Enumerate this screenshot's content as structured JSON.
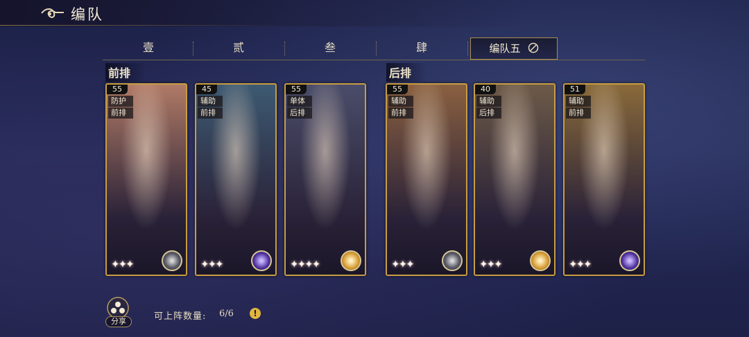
{
  "header": {
    "title": "编队"
  },
  "tabs": [
    {
      "label": "壹"
    },
    {
      "label": "贰"
    },
    {
      "label": "叁"
    },
    {
      "label": "肆"
    },
    {
      "label": "编队五",
      "active": true
    }
  ],
  "sections": {
    "front": "前排",
    "back": "后排"
  },
  "cards": [
    {
      "level": "55",
      "role": "防护",
      "position": "前排",
      "stars": 3,
      "element_icon": "moon-disc-icon",
      "bg": "#b07a66"
    },
    {
      "level": "45",
      "role": "辅助",
      "position": "前排",
      "stars": 3,
      "element_icon": "purple-orb-icon",
      "bg": "#3d5a72"
    },
    {
      "level": "55",
      "role": "单体",
      "position": "后排",
      "stars": 4,
      "element_icon": "gold-orb-icon",
      "bg": "#4a4d6a"
    },
    {
      "level": "55",
      "role": "辅助",
      "position": "前排",
      "stars": 3,
      "element_icon": "moon-disc-icon",
      "bg": "#8a6040"
    },
    {
      "level": "40",
      "role": "辅助",
      "position": "后排",
      "stars": 3,
      "element_icon": "gold-orb-icon",
      "bg": "#6d5a48"
    },
    {
      "level": "51",
      "role": "辅助",
      "position": "前排",
      "stars": 3,
      "element_icon": "purple-orb-icon",
      "bg": "#8a6a3a"
    }
  ],
  "footer": {
    "share_label": "分享",
    "deploy_label": "可上阵数量:",
    "deploy_value": "6/6",
    "info_glyph": "!"
  }
}
